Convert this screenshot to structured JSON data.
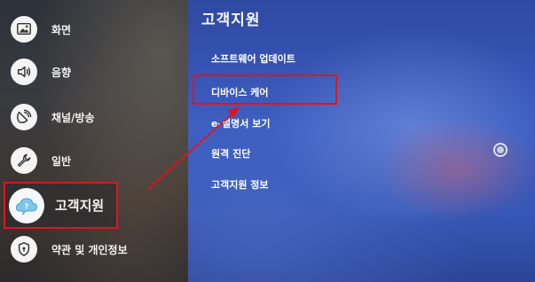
{
  "sidebar": {
    "items": [
      {
        "label": "화면",
        "icon": "picture-icon"
      },
      {
        "label": "음향",
        "icon": "speaker-icon"
      },
      {
        "label": "채널/방송",
        "icon": "satellite-icon"
      },
      {
        "label": "일반",
        "icon": "wrench-icon"
      },
      {
        "label": "고객지원",
        "icon": "support-cloud-icon",
        "selected": true
      },
      {
        "label": "약관 및 개인정보",
        "icon": "shield-lock-icon"
      }
    ]
  },
  "panel": {
    "title": "고객지원",
    "items": [
      {
        "label": "소프트웨어 업데이트"
      },
      {
        "label": "디바이스 케어",
        "highlighted": true
      },
      {
        "label": "e-설명서 보기"
      },
      {
        "label": "원격 진단",
        "radio": true
      },
      {
        "label": "고객지원 정보"
      }
    ]
  },
  "annotation": {
    "highlight_color": "#e0141e"
  }
}
